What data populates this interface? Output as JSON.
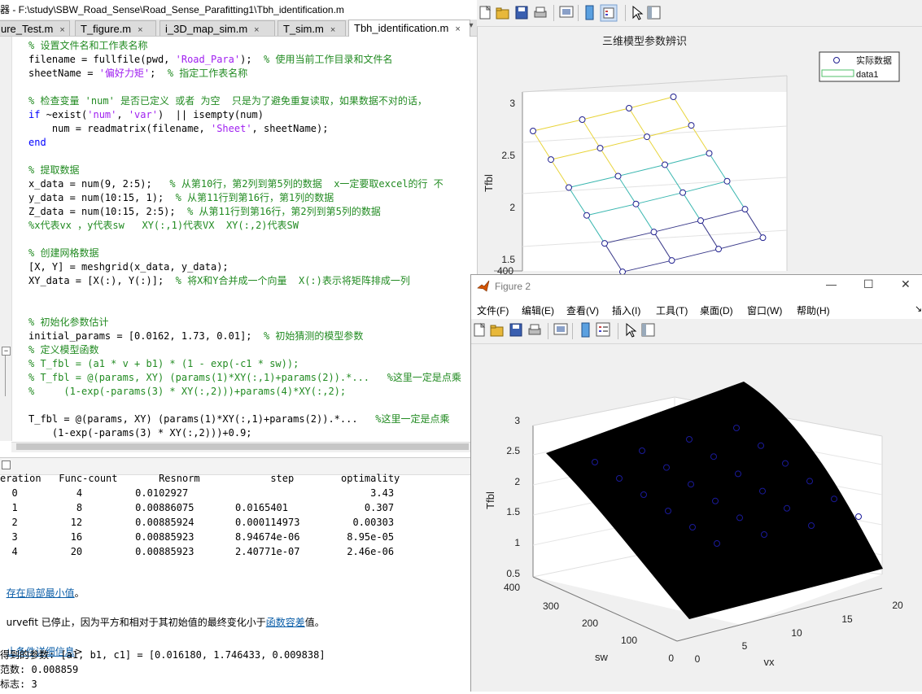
{
  "editor": {
    "title": "器 - F:\\study\\SBW_Road_Sense\\Road_Sense_Parafitting1\\Tbh_identification.m",
    "tabs": [
      {
        "label": "ure_Test.m"
      },
      {
        "label": "T_figure.m"
      },
      {
        "label": "i_3D_map_sim.m"
      },
      {
        "label": "T_sim.m"
      },
      {
        "label": "Tbh_identification.m"
      }
    ],
    "close_glyph": "×",
    "code_lines": [
      [
        {
          "c": "cm",
          "t": "% 设置文件名和工作表名称"
        }
      ],
      [
        {
          "c": "tx",
          "t": "filename = fullfile(pwd, "
        },
        {
          "c": "st",
          "t": "'Road_Para'"
        },
        {
          "c": "tx",
          "t": ");  "
        },
        {
          "c": "cm",
          "t": "% 使用当前工作目录和文件名"
        }
      ],
      [
        {
          "c": "tx",
          "t": "sheetName = "
        },
        {
          "c": "st",
          "t": "'偏好力矩'"
        },
        {
          "c": "tx",
          "t": ";  "
        },
        {
          "c": "cm",
          "t": "% 指定工作表名称"
        }
      ],
      [
        {
          "c": "tx",
          "t": ""
        }
      ],
      [
        {
          "c": "cm",
          "t": "% 检查变量 'num' 是否已定义 或者 为空  只是为了避免重复读取，如果数据不对的话，"
        }
      ],
      [
        {
          "c": "kw",
          "t": "if"
        },
        {
          "c": "tx",
          "t": " ~exist("
        },
        {
          "c": "st",
          "t": "'num'"
        },
        {
          "c": "tx",
          "t": ", "
        },
        {
          "c": "st",
          "t": "'var'"
        },
        {
          "c": "tx",
          "t": ")  || isempty(num)"
        }
      ],
      [
        {
          "c": "tx",
          "t": "    num = readmatrix(filename, "
        },
        {
          "c": "st",
          "t": "'Sheet'"
        },
        {
          "c": "tx",
          "t": ", sheetName);"
        }
      ],
      [
        {
          "c": "kw",
          "t": "end"
        }
      ],
      [
        {
          "c": "tx",
          "t": ""
        }
      ],
      [
        {
          "c": "cm",
          "t": "% 提取数据"
        }
      ],
      [
        {
          "c": "tx",
          "t": "x_data = num(9, 2:5);   "
        },
        {
          "c": "cm",
          "t": "% 从第10行，第2列到第5列的数据  x一定要取excel的行 不"
        }
      ],
      [
        {
          "c": "tx",
          "t": "y_data = num(10:15, 1);  "
        },
        {
          "c": "cm",
          "t": "% 从第11行到第16行，第1列的数据"
        }
      ],
      [
        {
          "c": "tx",
          "t": "Z_data = num(10:15, 2:5);  "
        },
        {
          "c": "cm",
          "t": "% 从第11行到第16行，第2列到第5列的数据"
        }
      ],
      [
        {
          "c": "cm",
          "t": "%x代表vx ，y代表sw   XY(:,1)代表VX  XY(:,2)代表SW"
        }
      ],
      [
        {
          "c": "tx",
          "t": ""
        }
      ],
      [
        {
          "c": "cm",
          "t": "% 创建网格数据"
        }
      ],
      [
        {
          "c": "tx",
          "t": "[X, Y] = meshgrid(x_data, y_data);"
        }
      ],
      [
        {
          "c": "tx",
          "t": "XY_data = [X(:), Y(:)];  "
        },
        {
          "c": "cm",
          "t": "% 将X和Y合并成一个向量  X(:)表示将矩阵排成一列"
        }
      ],
      [
        {
          "c": "tx",
          "t": ""
        }
      ],
      [
        {
          "c": "tx",
          "t": ""
        }
      ],
      [
        {
          "c": "cm",
          "t": "% 初始化参数估计"
        }
      ],
      [
        {
          "c": "tx",
          "t": "initial_params = [0.0162, 1.73, 0.01];  "
        },
        {
          "c": "cm",
          "t": "% 初始猜测的模型参数"
        }
      ],
      [
        {
          "c": "cm",
          "t": "% 定义模型函数"
        }
      ],
      [
        {
          "c": "cm",
          "t": "% T_fbl = (a1 * v + b1) * (1 - exp(-c1 * sw));"
        }
      ],
      [
        {
          "c": "cm",
          "t": "% T_fbl = @(params, XY) (params(1)*XY(:,1)+params(2)).*...   %这里一定是点乘"
        }
      ],
      [
        {
          "c": "cm",
          "t": "%     (1-exp(-params(3) * XY(:,2)))+params(4)*XY(:,2);"
        }
      ],
      [
        {
          "c": "tx",
          "t": ""
        }
      ],
      [
        {
          "c": "tx",
          "t": "T_fbl = @(params, XY) (params(1)*XY(:,1)+params(2)).*...   "
        },
        {
          "c": "cm",
          "t": "%这里一定是点乘"
        }
      ],
      [
        {
          "c": "tx",
          "t": "    (1-exp(-params(3) * XY(:,2)))+0.9;"
        }
      ]
    ]
  },
  "command": {
    "header_row": "eration   Func-count       Resnorm            step        optimality",
    "rows": [
      "  0          4         0.0102927                               3.43",
      "  1          8         0.00886075       0.0165401             0.307",
      "  2         12         0.00885924       0.000114973         0.00303",
      "  3         16         0.00885923       8.94674e-06        8.95e-05",
      "  4         20         0.00885923       2.40771e-07        2.46e-06"
    ],
    "local_min_link": "存在局部最小值",
    "local_min_tail": "。",
    "stop_prefix": "urvefit 已停止，因为平方和相对于其初始值的最终变化小于",
    "stop_link": "函数容差",
    "stop_tail": "值。",
    "details_link": "止条件详细信息",
    "details_tail": ">",
    "params_line": "得到的参数: [a1, b1, c1] = [0.016180, 1.746433, 0.009838]",
    "resnorm_line": "范数: 0.008859",
    "flag_line": "标志: 3"
  },
  "figure1": {
    "title": "三维模型参数辨识",
    "legend": [
      "实际数据",
      "data1"
    ],
    "zlabel": "Tfbl",
    "z_ticks": [
      "3",
      "2.5",
      "2",
      "1.5"
    ],
    "y_tick_partial": "400",
    "colors": {
      "marker": "#1f1f8f",
      "surf_top": "#e8d43a",
      "surf_mid": "#3bb7b0",
      "surf_bot": "#3a3a8a"
    }
  },
  "figure2": {
    "window_title": "Figure 2",
    "menus": [
      "文件(F)",
      "编辑(E)",
      "查看(V)",
      "插入(I)",
      "工具(T)",
      "桌面(D)",
      "窗口(W)",
      "帮助(H)"
    ],
    "overflow_glyph": "↘",
    "win_buttons": [
      "—",
      "☐",
      "✕"
    ],
    "zlabel": "Tfbl",
    "xlabel": "vx",
    "ylabel": "sw",
    "z_ticks": [
      "3",
      "2.5",
      "2",
      "1.5",
      "1",
      "0.5"
    ],
    "x_ticks": [
      "0",
      "5",
      "10",
      "15",
      "20"
    ],
    "y_ticks": [
      "400",
      "300",
      "200",
      "100",
      "0"
    ],
    "colors": {
      "surface": "#000000",
      "marker": "#1a1a9a",
      "grid": "#d9d9d9"
    }
  },
  "chart_data": [
    {
      "type": "scatter",
      "title": "三维模型参数辨识",
      "zlabel": "Tfbl",
      "legend": [
        "实际数据",
        "data1"
      ],
      "legend_position": "top-right",
      "grid": true
    },
    {
      "type": "scatter",
      "title": "",
      "xlabel": "vx",
      "ylabel": "sw",
      "zlabel": "Tfbl",
      "xlim": [
        0,
        20
      ],
      "ylim": [
        0,
        400
      ],
      "zlim": [
        0.5,
        3
      ],
      "grid": true
    }
  ]
}
